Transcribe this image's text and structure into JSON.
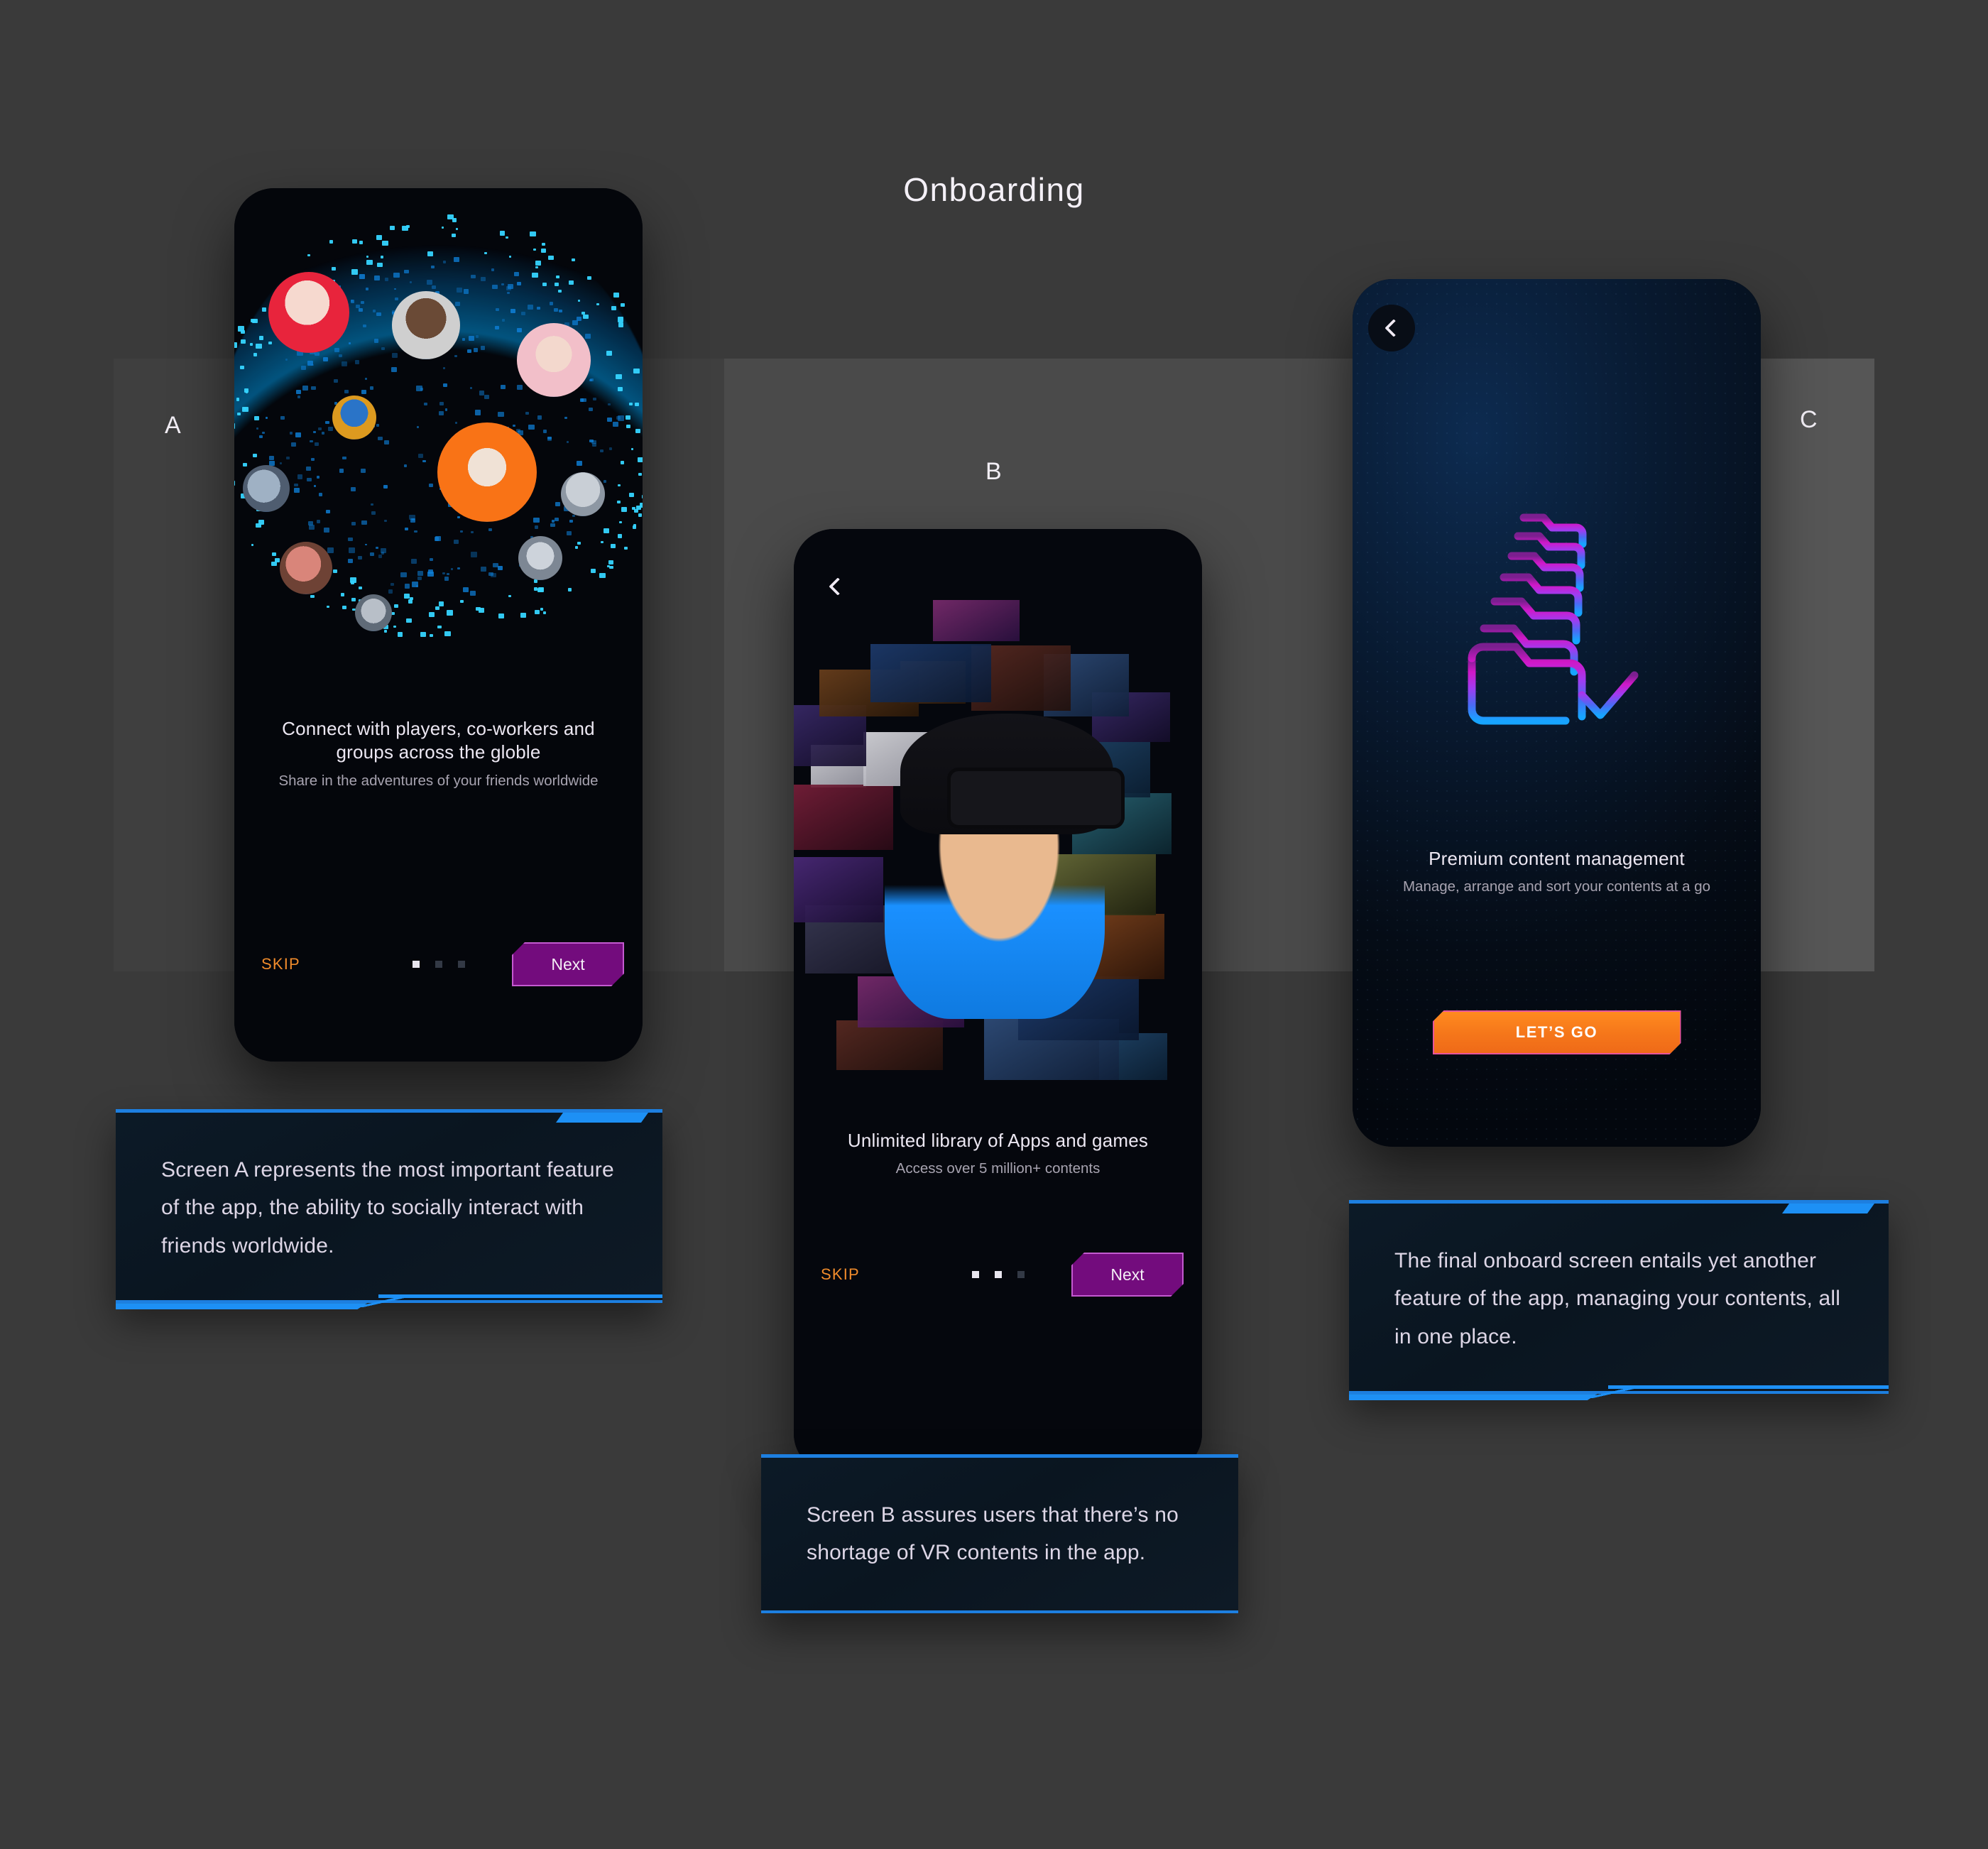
{
  "page": {
    "title": "Onboarding",
    "background_color": "#3a3a3a",
    "accent_blue": "#1d90f5",
    "accent_orange": "#f08b2b",
    "accent_purple": "#730c7d"
  },
  "panels": [
    {
      "letter": "A"
    },
    {
      "letter": "B"
    },
    {
      "letter": "C"
    }
  ],
  "screens": [
    {
      "id": "screen-a",
      "title": "Connect with players, co-workers and groups across the globle",
      "subtitle": "Share in the adventures of your friends worldwide",
      "skip_label": "SKIP",
      "next_label": "Next",
      "pager": {
        "total": 3,
        "active": 1
      },
      "hero": "vr-social-sphere-illustration",
      "back_icon": null
    },
    {
      "id": "screen-b",
      "title": "Unlimited library of Apps and games",
      "subtitle": "Access over 5 million+ contents",
      "skip_label": "SKIP",
      "next_label": "Next",
      "pager": {
        "total": 3,
        "active": 2
      },
      "hero": "vr-content-collage-illustration",
      "back_icon": "chevron-left-icon"
    },
    {
      "id": "screen-c",
      "title": "Premium content management",
      "subtitle": "Manage, arrange and sort your contents at a go",
      "cta_label": "LET’S GO",
      "hero": "stacked-folder-check-icon",
      "back_icon": "chevron-left-icon"
    }
  ],
  "annotations": [
    {
      "id": "anno-a",
      "text": "Screen A represents the most important feature of the app, the ability to socially interact with friends worldwide."
    },
    {
      "id": "anno-b",
      "text": "Screen B assures users that there’s no shortage of VR contents in the app."
    },
    {
      "id": "anno-c",
      "text": "The final onboard screen entails yet another feature of the app, managing your contents, all in one place."
    }
  ]
}
